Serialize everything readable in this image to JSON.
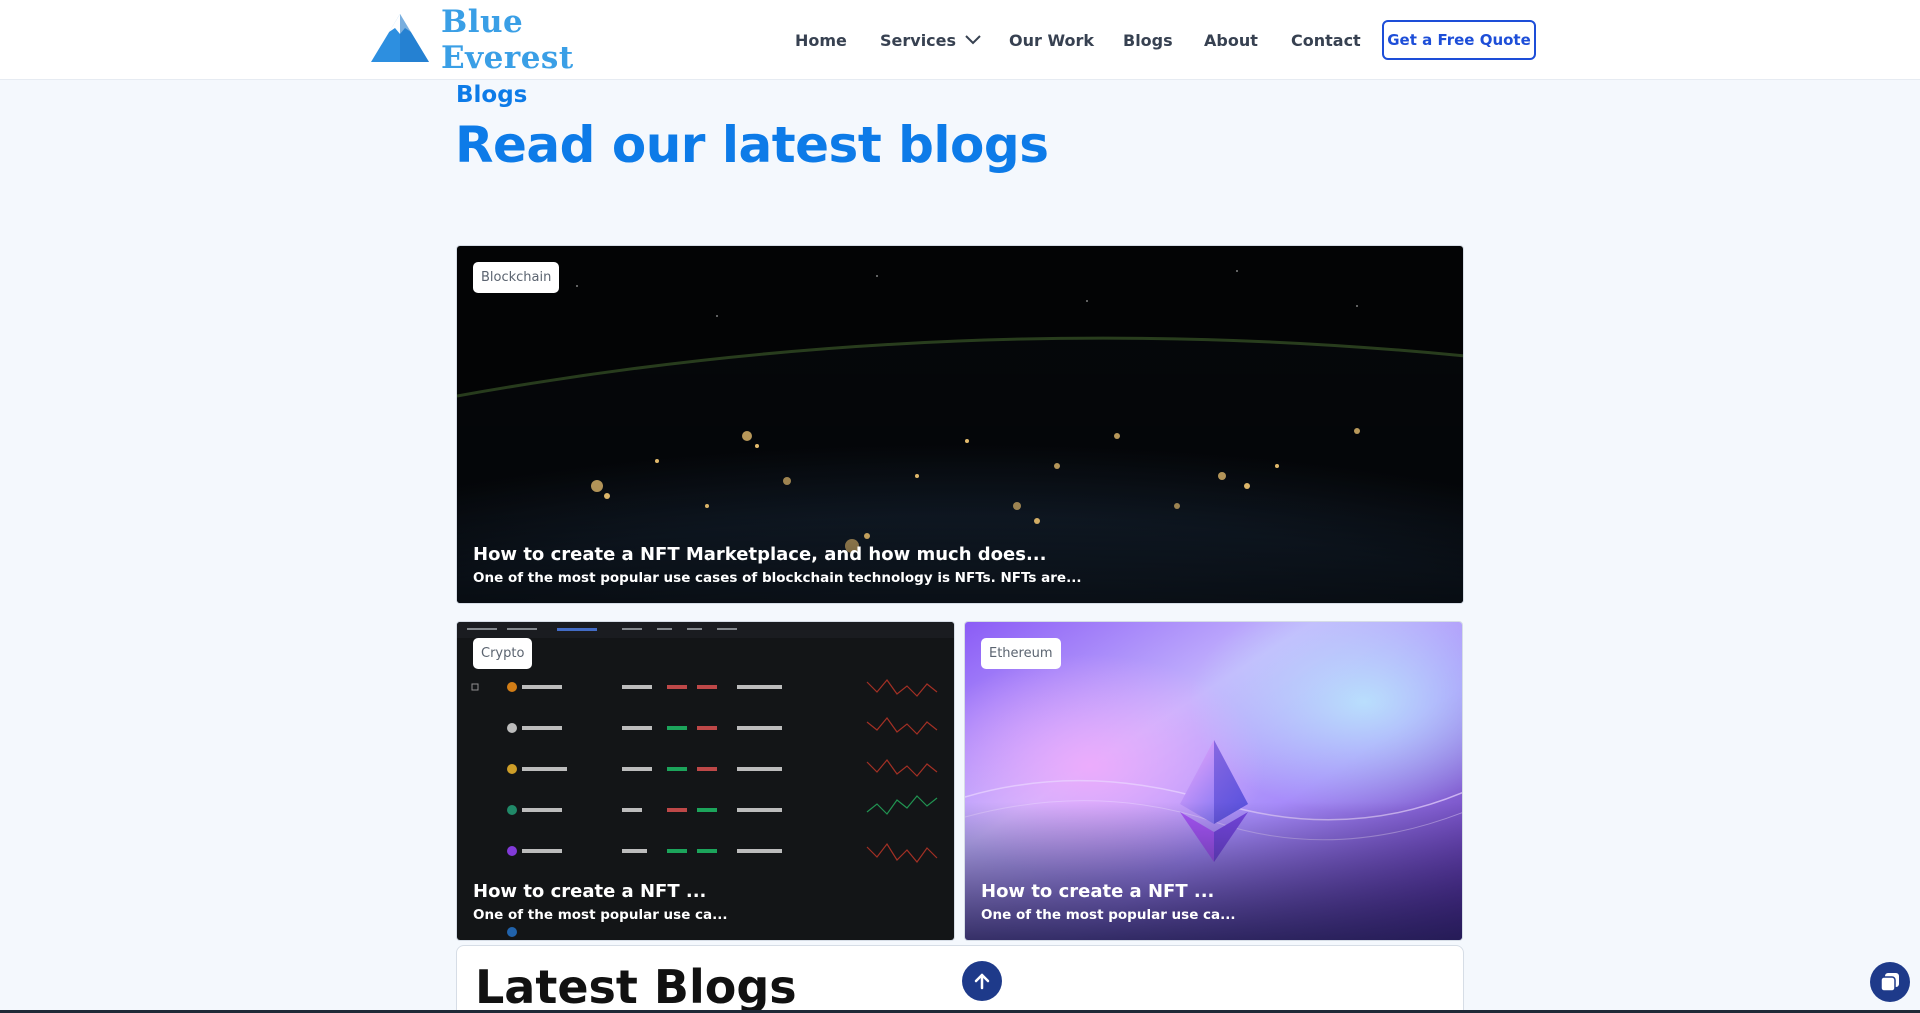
{
  "header": {
    "logo_text": "Blue Everest",
    "nav": {
      "home": "Home",
      "services": "Services",
      "our_work": "Our Work",
      "blogs": "Blogs",
      "about": "About",
      "contact": "Contact"
    },
    "cta": "Get a Free Quote"
  },
  "section": {
    "eyebrow": "Blogs",
    "headline": "Read our latest blogs"
  },
  "cards": [
    {
      "tag": "Blockchain",
      "title": "How to create a NFT Marketplace, and how much does...",
      "desc": "One of the most popular use cases of blockchain technology is NFTs. NFTs are..."
    },
    {
      "tag": "Crypto",
      "title": "How to create a NFT ...",
      "desc": "One of the most popular use ca..."
    },
    {
      "tag": "Ethereum",
      "title": "How to create a NFT ...",
      "desc": "One of the most popular use ca..."
    }
  ],
  "latest": {
    "title": "Latest Blogs"
  },
  "icons": {
    "logo": "mountain-logo-icon",
    "services_dropdown": "chevron-down-icon",
    "scroll_top": "arrow-up-icon",
    "chat": "chat-icon"
  },
  "colors": {
    "accent": "#0d7be8",
    "cta_border": "#1d4ed8",
    "dark_button": "#1e3a8a",
    "page_bg": "#f4f8fd"
  }
}
